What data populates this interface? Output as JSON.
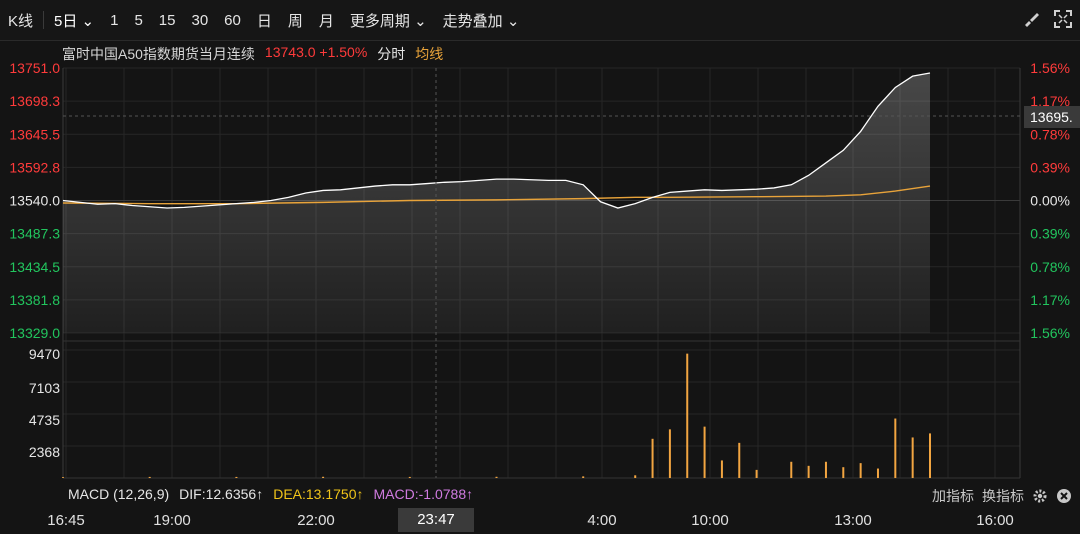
{
  "toolbar": {
    "kline": "K线",
    "period_selected": "5日",
    "periods": [
      "1",
      "5",
      "15",
      "30",
      "60",
      "日",
      "周",
      "月"
    ],
    "more_periods": "更多周期",
    "overlay": "走势叠加"
  },
  "legend": {
    "name": "富时中国A50指数期货当月连续",
    "price": "13743.0 +1.50%",
    "mode": "分时",
    "avg": "均线"
  },
  "price_axis": {
    "left_ticks": [
      "13751.0",
      "13698.3",
      "13645.5",
      "13592.8",
      "13540.0",
      "13487.3",
      "13434.5",
      "13381.8",
      "13329.0"
    ],
    "right_ticks": [
      "1.56%",
      "1.17%",
      "0.78%",
      "0.39%",
      "0.00%",
      "0.39%",
      "0.78%",
      "1.17%",
      "1.56%"
    ],
    "cursor_price": "13695."
  },
  "volume_axis": {
    "ticks": [
      "9470",
      "7103",
      "4735",
      "2368"
    ]
  },
  "macd": {
    "label": "MACD (12,26,9)",
    "dif": "DIF:12.6356↑",
    "dea": "DEA:13.1750↑",
    "macd": "MACD:-1.0788↑"
  },
  "controls": {
    "add_indicator": "加指标",
    "switch_indicator": "换指标"
  },
  "x_axis": {
    "labels": [
      "16:45",
      "19:00",
      "22:00",
      "4:00",
      "10:00",
      "13:00",
      "16:00"
    ],
    "cursor_time": "23:47"
  },
  "colors": {
    "up": "#ff3b3b",
    "down": "#22c55e",
    "avg": "#e8a33a",
    "price": "#ffffff",
    "volume": "#f2a541",
    "dif": "#e6e6e6",
    "dea": "#f0c419",
    "macd": "#d07be0"
  },
  "chart_data": {
    "type": "line",
    "series": [
      {
        "name": "分时",
        "x_pct": [
          0,
          2,
          4,
          6,
          8,
          10,
          12,
          14,
          16,
          18,
          20,
          22,
          24,
          26,
          28,
          30,
          32,
          34,
          36,
          38,
          40,
          42,
          44,
          46,
          48,
          50,
          52,
          54,
          56,
          58,
          60,
          62,
          64,
          66,
          68,
          70,
          72,
          74,
          76,
          78,
          80,
          82,
          84,
          86,
          88,
          90,
          92,
          94,
          96,
          98,
          100
        ],
        "values": [
          13540,
          13537,
          13534,
          13535,
          13532,
          13530,
          13528,
          13529,
          13531,
          13533,
          13535,
          13537,
          13540,
          13545,
          13552,
          13556,
          13557,
          13560,
          13563,
          13565,
          13565,
          13567,
          13569,
          13570,
          13572,
          13574,
          13574,
          13573,
          13572,
          13572,
          13565,
          13538,
          13528,
          13535,
          13545,
          13553,
          13555,
          13557,
          13556,
          13557,
          13558,
          13560,
          13565,
          13580,
          13600,
          13620,
          13650,
          13690,
          13720,
          13738,
          13743
        ]
      },
      {
        "name": "均线",
        "x_pct": [
          0,
          10,
          20,
          30,
          40,
          50,
          60,
          66,
          70,
          80,
          88,
          92,
          96,
          100
        ],
        "values": [
          13536,
          13535,
          13535,
          13537,
          13540,
          13541,
          13543,
          13545,
          13545,
          13546,
          13547,
          13549,
          13555,
          13563
        ]
      }
    ],
    "volume": {
      "x_pct": [
        0,
        10,
        20,
        30,
        40,
        50,
        60,
        66,
        68,
        70,
        72,
        74,
        76,
        78,
        80,
        84,
        86,
        88,
        90,
        92,
        94,
        96,
        98,
        100
      ],
      "values": [
        60,
        80,
        80,
        90,
        80,
        90,
        120,
        200,
        2900,
        3600,
        9200,
        3800,
        1300,
        2600,
        600,
        1200,
        900,
        1200,
        800,
        1100,
        700,
        4400,
        3000,
        3300
      ]
    },
    "ylim": [
      13329.0,
      13751.0
    ],
    "volume_ylim": [
      0,
      9470
    ]
  }
}
